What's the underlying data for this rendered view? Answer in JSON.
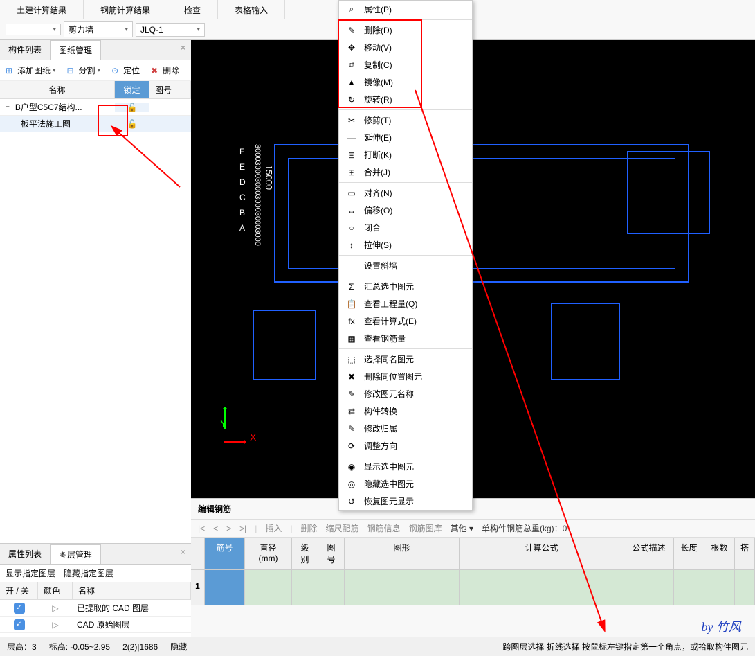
{
  "top_tabs": [
    "土建计算结果",
    "钢筋计算结果",
    "检查",
    "表格输入"
  ],
  "dropdowns": {
    "d1": "",
    "d2": "剪力墙",
    "d3": "JLQ-1"
  },
  "left": {
    "tabs": [
      "构件列表",
      "图纸管理"
    ],
    "toolbar": {
      "add": "添加图纸",
      "split": "分割",
      "locate": "定位",
      "delete": "删除"
    },
    "cols": {
      "name": "名称",
      "lock": "锁定",
      "num": "图号"
    },
    "rows": [
      {
        "name": "B户型C5C7结构...",
        "indent": 0,
        "expand": "−"
      },
      {
        "name": "板平法施工图",
        "indent": 1,
        "expand": ""
      }
    ]
  },
  "lower": {
    "tabs": [
      "属性列表",
      "图层管理"
    ],
    "btns": {
      "show": "显示指定图层",
      "hide": "隐藏指定图层"
    },
    "cols": {
      "toggle": "开 / 关",
      "color": "颜色",
      "name": "名称"
    },
    "rows": [
      {
        "name": "已提取的 CAD 图层"
      },
      {
        "name": "CAD 原始图层"
      }
    ]
  },
  "menu": [
    {
      "icon": "⌕",
      "label": "属性(P)",
      "sep_after": true
    },
    {
      "icon": "✎",
      "label": "删除(D)"
    },
    {
      "icon": "✥",
      "label": "移动(V)"
    },
    {
      "icon": "⧉",
      "label": "复制(C)"
    },
    {
      "icon": "▲",
      "label": "镜像(M)"
    },
    {
      "icon": "↻",
      "label": "旋转(R)",
      "sep_after": true
    },
    {
      "icon": "✂",
      "label": "修剪(T)"
    },
    {
      "icon": "—",
      "label": "延伸(E)"
    },
    {
      "icon": "⊟",
      "label": "打断(K)"
    },
    {
      "icon": "⊞",
      "label": "合并(J)",
      "sep_after": true
    },
    {
      "icon": "▭",
      "label": "对齐(N)"
    },
    {
      "icon": "↔",
      "label": "偏移(O)"
    },
    {
      "icon": "○",
      "label": "闭合"
    },
    {
      "icon": "↕",
      "label": "拉伸(S)",
      "sep_after": true
    },
    {
      "icon": "",
      "label": "设置斜墙",
      "sep_after": true
    },
    {
      "icon": "Σ",
      "label": "汇总选中图元"
    },
    {
      "icon": "📋",
      "label": "查看工程量(Q)"
    },
    {
      "icon": "fx",
      "label": "查看计算式(E)"
    },
    {
      "icon": "▦",
      "label": "查看钢筋量",
      "sep_after": true
    },
    {
      "icon": "⬚",
      "label": "选择同名图元"
    },
    {
      "icon": "✖",
      "label": "删除同位置图元"
    },
    {
      "icon": "✎",
      "label": "修改图元名称"
    },
    {
      "icon": "⇄",
      "label": "构件转换"
    },
    {
      "icon": "✎",
      "label": "修改归属"
    },
    {
      "icon": "⟳",
      "label": "调整方向",
      "sep_after": true
    },
    {
      "icon": "◉",
      "label": "显示选中图元"
    },
    {
      "icon": "◎",
      "label": "隐藏选中图元"
    },
    {
      "icon": "↺",
      "label": "恢复图元显示"
    }
  ],
  "axis": {
    "y": "Y",
    "x": "X"
  },
  "grid_v": [
    "F",
    "E",
    "D",
    "C",
    "B",
    "A"
  ],
  "bottom": {
    "title": "编辑钢筋",
    "tb": {
      "insert": "插入",
      "delete": "删除",
      "scale": "缩尺配筋",
      "info": "钢筋信息",
      "lib": "钢筋图库",
      "other": "其他",
      "total_label": "单构件钢筋总重(kg)：",
      "total_val": "0"
    },
    "cols": {
      "jh": "筋号",
      "dia": "直径(mm)",
      "lvl": "级别",
      "th": "图号",
      "shape": "图形",
      "formula": "计算公式",
      "desc": "公式描述",
      "len": "长度",
      "cnt": "根数",
      "extra": "搭"
    },
    "row_num": "1"
  },
  "status": {
    "floor_h": "层高：3",
    "elev": "标高: -0.05~2.95",
    "coord": "2(2)|1686",
    "hide": "隐藏",
    "hint": "跨图层选择   折线选择  按鼠标左键指定第一个角点，或拾取构件图元"
  },
  "signature": "by 竹风"
}
